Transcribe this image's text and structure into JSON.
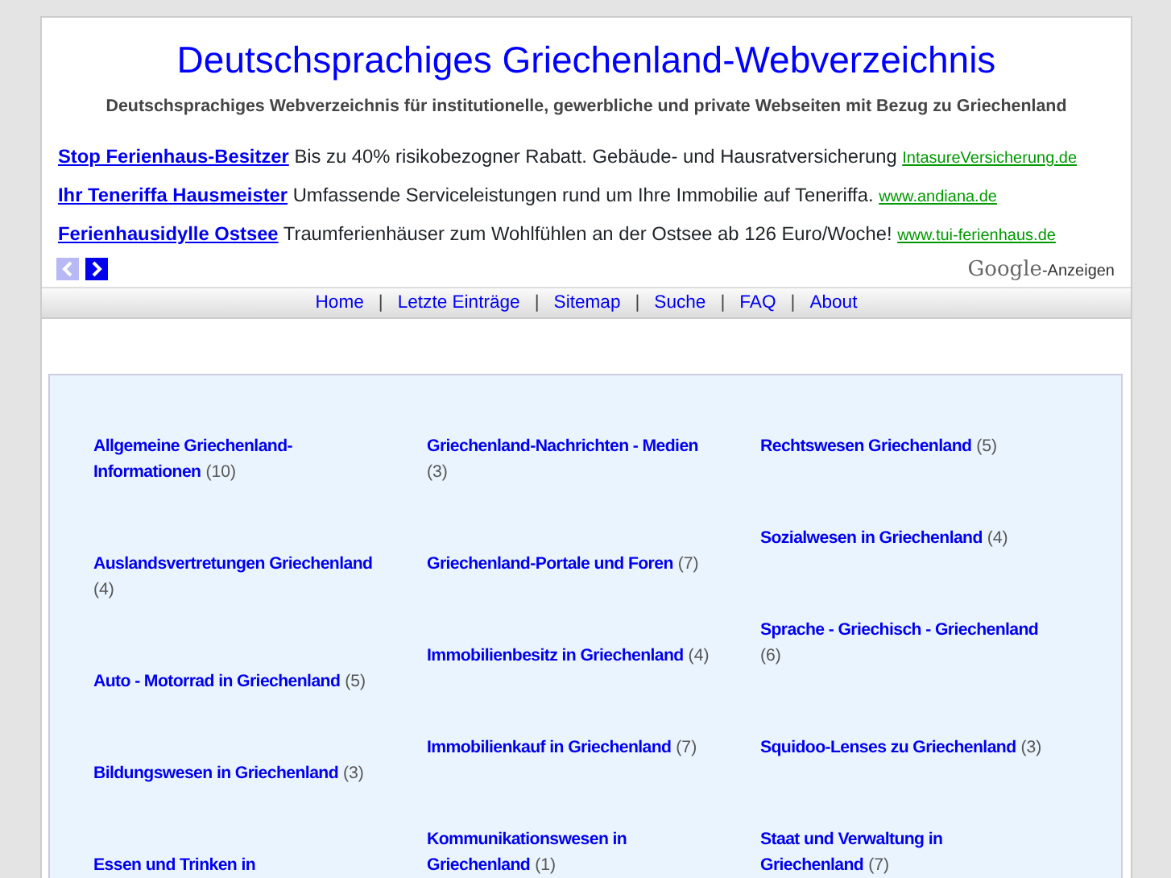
{
  "header": {
    "title": "Deutschsprachiges Griechenland-Webverzeichnis",
    "subtitle": "Deutschsprachiges Webverzeichnis für institutionelle, gewerbliche und private Webseiten mit Bezug zu Griechenland"
  },
  "ads": [
    {
      "title": "Stop Ferienhaus-Besitzer",
      "text": "Bis zu 40% risikobezogner Rabatt. Gebäude- und Hausratversicherung",
      "url": "IntasureVersicherung.de"
    },
    {
      "title": "Ihr Teneriffa Hausmeister",
      "text": "Umfassende Serviceleistungen rund um Ihre Immobilie auf Teneriffa.",
      "url": "www.andiana.de"
    },
    {
      "title": "Ferienhausidylle Ostsee",
      "text": "Traumferienhäuser zum Wohlfühlen an der Ostsee ab 126 Euro/Woche!",
      "url": "www.tui-ferienhaus.de"
    }
  ],
  "ad_pager": [
    {
      "kind": "prev",
      "disabled": true
    },
    {
      "kind": "next",
      "disabled": false
    }
  ],
  "ad_credit": {
    "brand": "Google",
    "label": "-Anzeigen"
  },
  "nav": [
    {
      "kind": "link",
      "text": "Home"
    },
    {
      "kind": "separator",
      "text": "|"
    },
    {
      "kind": "link",
      "text": "Letzte Einträge"
    },
    {
      "kind": "separator",
      "text": "|"
    },
    {
      "kind": "link",
      "text": "Sitemap"
    },
    {
      "kind": "separator",
      "text": "|"
    },
    {
      "kind": "link",
      "text": "Suche"
    },
    {
      "kind": "separator",
      "text": "|"
    },
    {
      "kind": "link",
      "text": "FAQ"
    },
    {
      "kind": "separator",
      "text": "|"
    },
    {
      "kind": "link",
      "text": "About"
    }
  ],
  "categories": [
    [
      {
        "name": "Allgemeine Griechenland-Informationen",
        "count": "(10)"
      },
      {
        "name": "Auslandsvertretungen Griechenland",
        "count": "(4)"
      },
      {
        "name": "Auto - Motorrad in Griechenland",
        "count": "(5)"
      },
      {
        "name": "Bildungswesen in Griechenland",
        "count": "(3)"
      },
      {
        "name": "Essen und Trinken in"
      }
    ],
    [
      {
        "name": "Griechenland-Nachrichten - Medien",
        "count": "(3)"
      },
      {
        "name": "Griechenland-Portale und Foren",
        "count": "(7)"
      },
      {
        "name": "Immobilienbesitz in Griechenland",
        "count": "(4)"
      },
      {
        "name": "Immobilienkauf in Griechenland",
        "count": "(7)"
      },
      {
        "name": "Kommunikationswesen in Griechenland",
        "count": "(1)"
      }
    ],
    [
      {
        "name": "Rechtswesen Griechenland",
        "count": "(5)"
      },
      {
        "name": "Sozialwesen in Griechenland",
        "count": "(4)"
      },
      {
        "name": "Sprache - Griechisch - Griechenland",
        "count": "(6)"
      },
      {
        "name": "Squidoo-Lenses zu Griechenland",
        "count": "(3)"
      },
      {
        "name": "Staat und Verwaltung in Griechenland",
        "count": "(7)"
      }
    ]
  ]
}
